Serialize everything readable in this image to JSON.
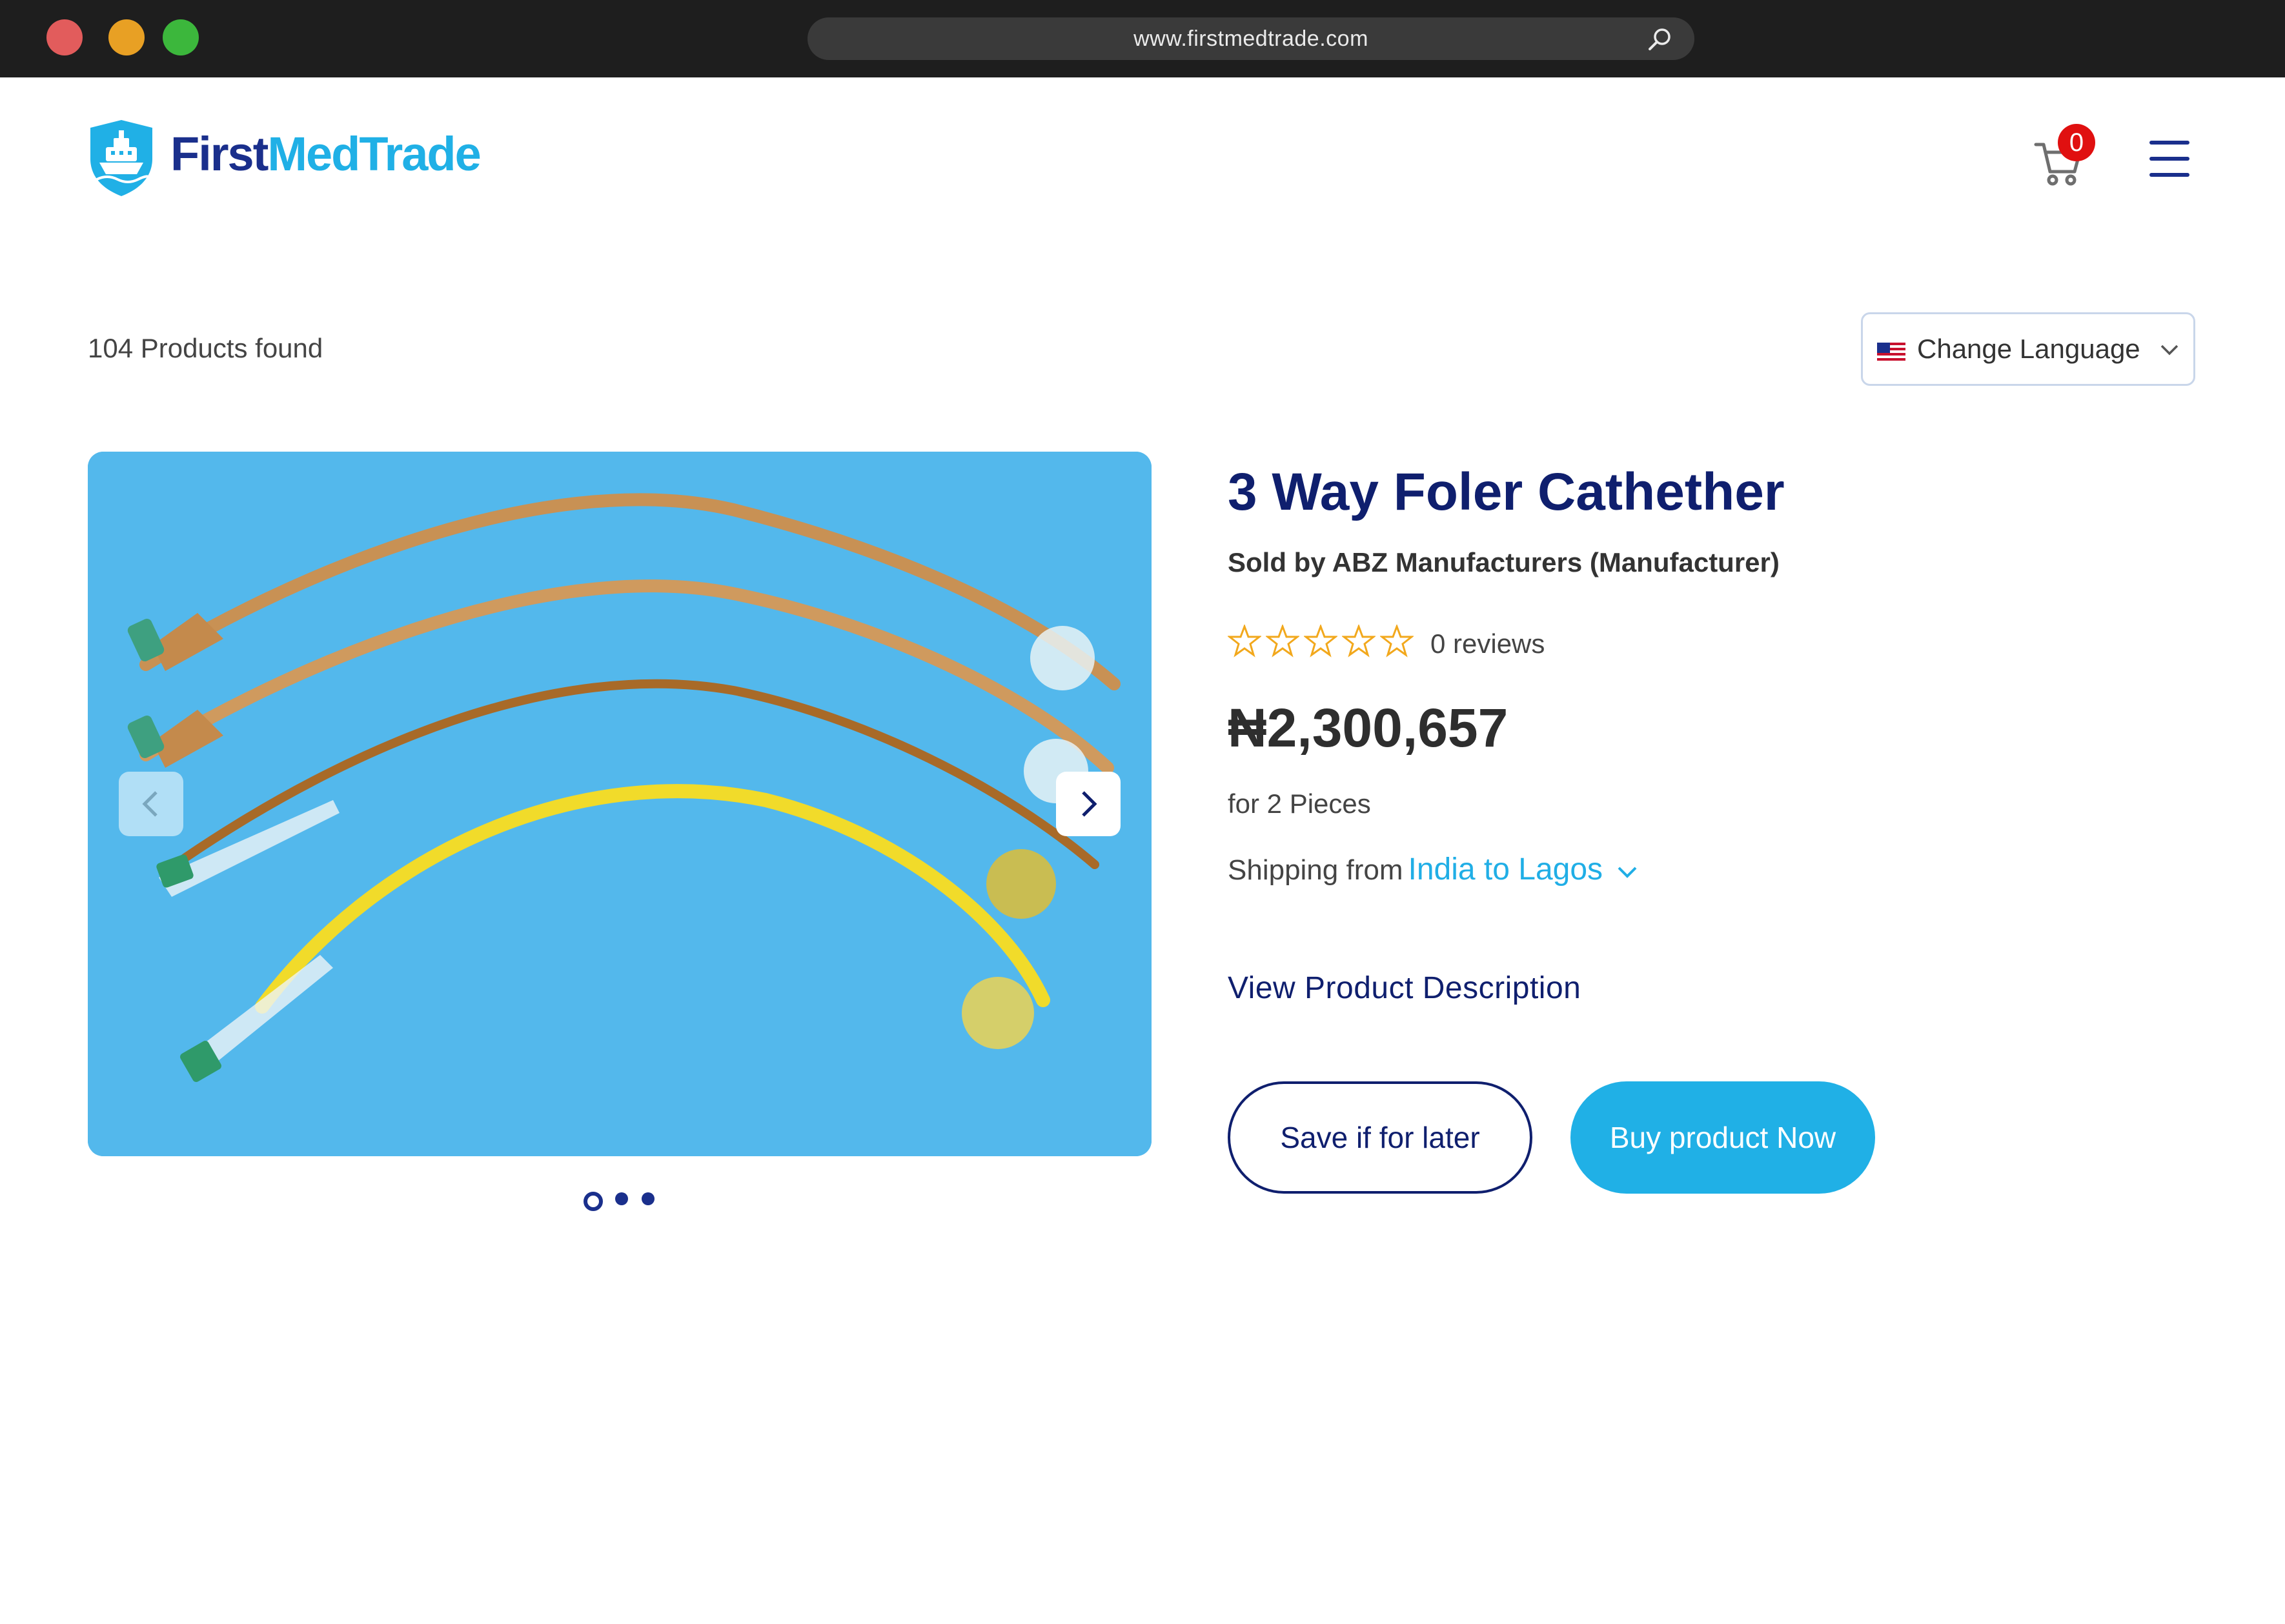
{
  "browser": {
    "url": "www.firstmedtrade.com"
  },
  "header": {
    "logo_first": "First",
    "logo_medtrade": "MedTrade",
    "cart_count": "0"
  },
  "results": {
    "count_text": "104 Products found",
    "language_label": "Change Language"
  },
  "gallery": {
    "slide_count": 3,
    "active_slide": 1
  },
  "product": {
    "title": "3 Way Foler Cathether",
    "seller": "Sold by ABZ Manufacturers (Manufacturer)",
    "rating": 0,
    "reviews": "0 reviews",
    "price": "₦2,300,657",
    "quantity": "for 2 Pieces",
    "shipping_label": "Shipping from",
    "shipping_route": "India to Lagos",
    "description_link": "View Product Description",
    "save_label": "Save if for later",
    "buy_label": "Buy product Now"
  },
  "colors": {
    "brand_navy": "#0f1f6e",
    "brand_cyan": "#20b0e6",
    "badge_red": "#e01010",
    "star_orange": "#f2a81c"
  }
}
